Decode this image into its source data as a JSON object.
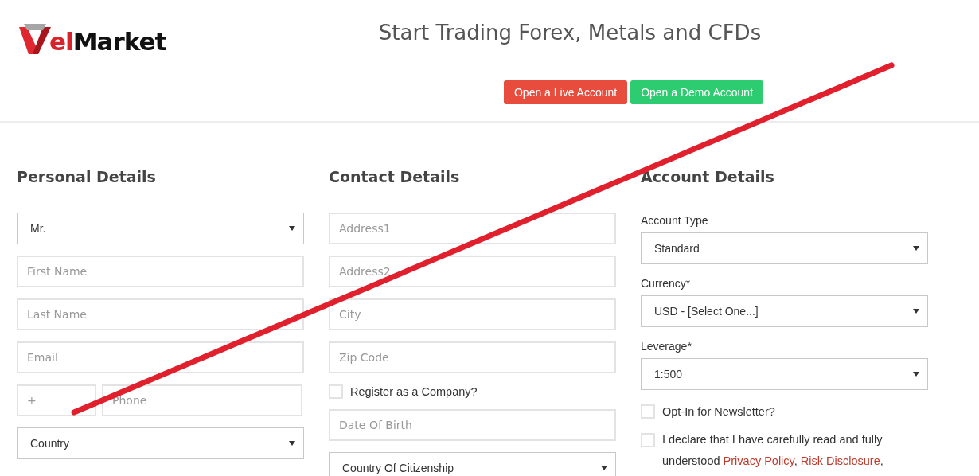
{
  "logo": {
    "accent": "el",
    "rest": "Market"
  },
  "header": {
    "title": "Start Trading Forex, Metals and CFDs",
    "buttons": [
      {
        "label": "Open a Live Account",
        "kind": "live"
      },
      {
        "label": "Open a Demo Account",
        "kind": "demo"
      }
    ]
  },
  "sections": [
    {
      "title": "Personal Details",
      "fields": [
        {
          "kind": "select",
          "value": "Mr."
        },
        {
          "kind": "input",
          "placeholder": "First Name"
        },
        {
          "kind": "input",
          "placeholder": "Last Name"
        },
        {
          "kind": "input",
          "placeholder": "Email"
        },
        {
          "kind": "phone",
          "code": "+",
          "placeholder": "Phone"
        },
        {
          "kind": "select",
          "value": "Country"
        }
      ]
    },
    {
      "title": "Contact Details",
      "fields": [
        {
          "kind": "input",
          "placeholder": "Address1"
        },
        {
          "kind": "input",
          "placeholder": "Address2"
        },
        {
          "kind": "input",
          "placeholder": "City"
        },
        {
          "kind": "input",
          "placeholder": "Zip Code"
        },
        {
          "kind": "checkbox",
          "label": "Register as a Company?",
          "checked": false
        },
        {
          "kind": "input",
          "placeholder": "Date Of Birth"
        },
        {
          "kind": "select",
          "value": "Country Of Citizenship"
        }
      ]
    },
    {
      "title": "Account Details",
      "fields": [
        {
          "kind": "labeled-select",
          "label": "Account Type",
          "value": "Standard"
        },
        {
          "kind": "labeled-select",
          "label": "Currency*",
          "value": "USD - [Select One...]"
        },
        {
          "kind": "labeled-select",
          "label": "Leverage*",
          "value": "1:500"
        },
        {
          "kind": "checkbox",
          "label": "Opt-In for Newsletter?",
          "checked": false
        },
        {
          "kind": "consent",
          "checked": false,
          "parts": [
            {
              "kind": "text",
              "text": "I declare that I have carefully read and fully understood "
            },
            {
              "kind": "link",
              "text": "Privacy Policy"
            },
            {
              "kind": "text",
              "text": ", "
            },
            {
              "kind": "link",
              "text": "Risk Disclosure"
            },
            {
              "kind": "text",
              "text": ","
            }
          ]
        }
      ]
    }
  ]
}
